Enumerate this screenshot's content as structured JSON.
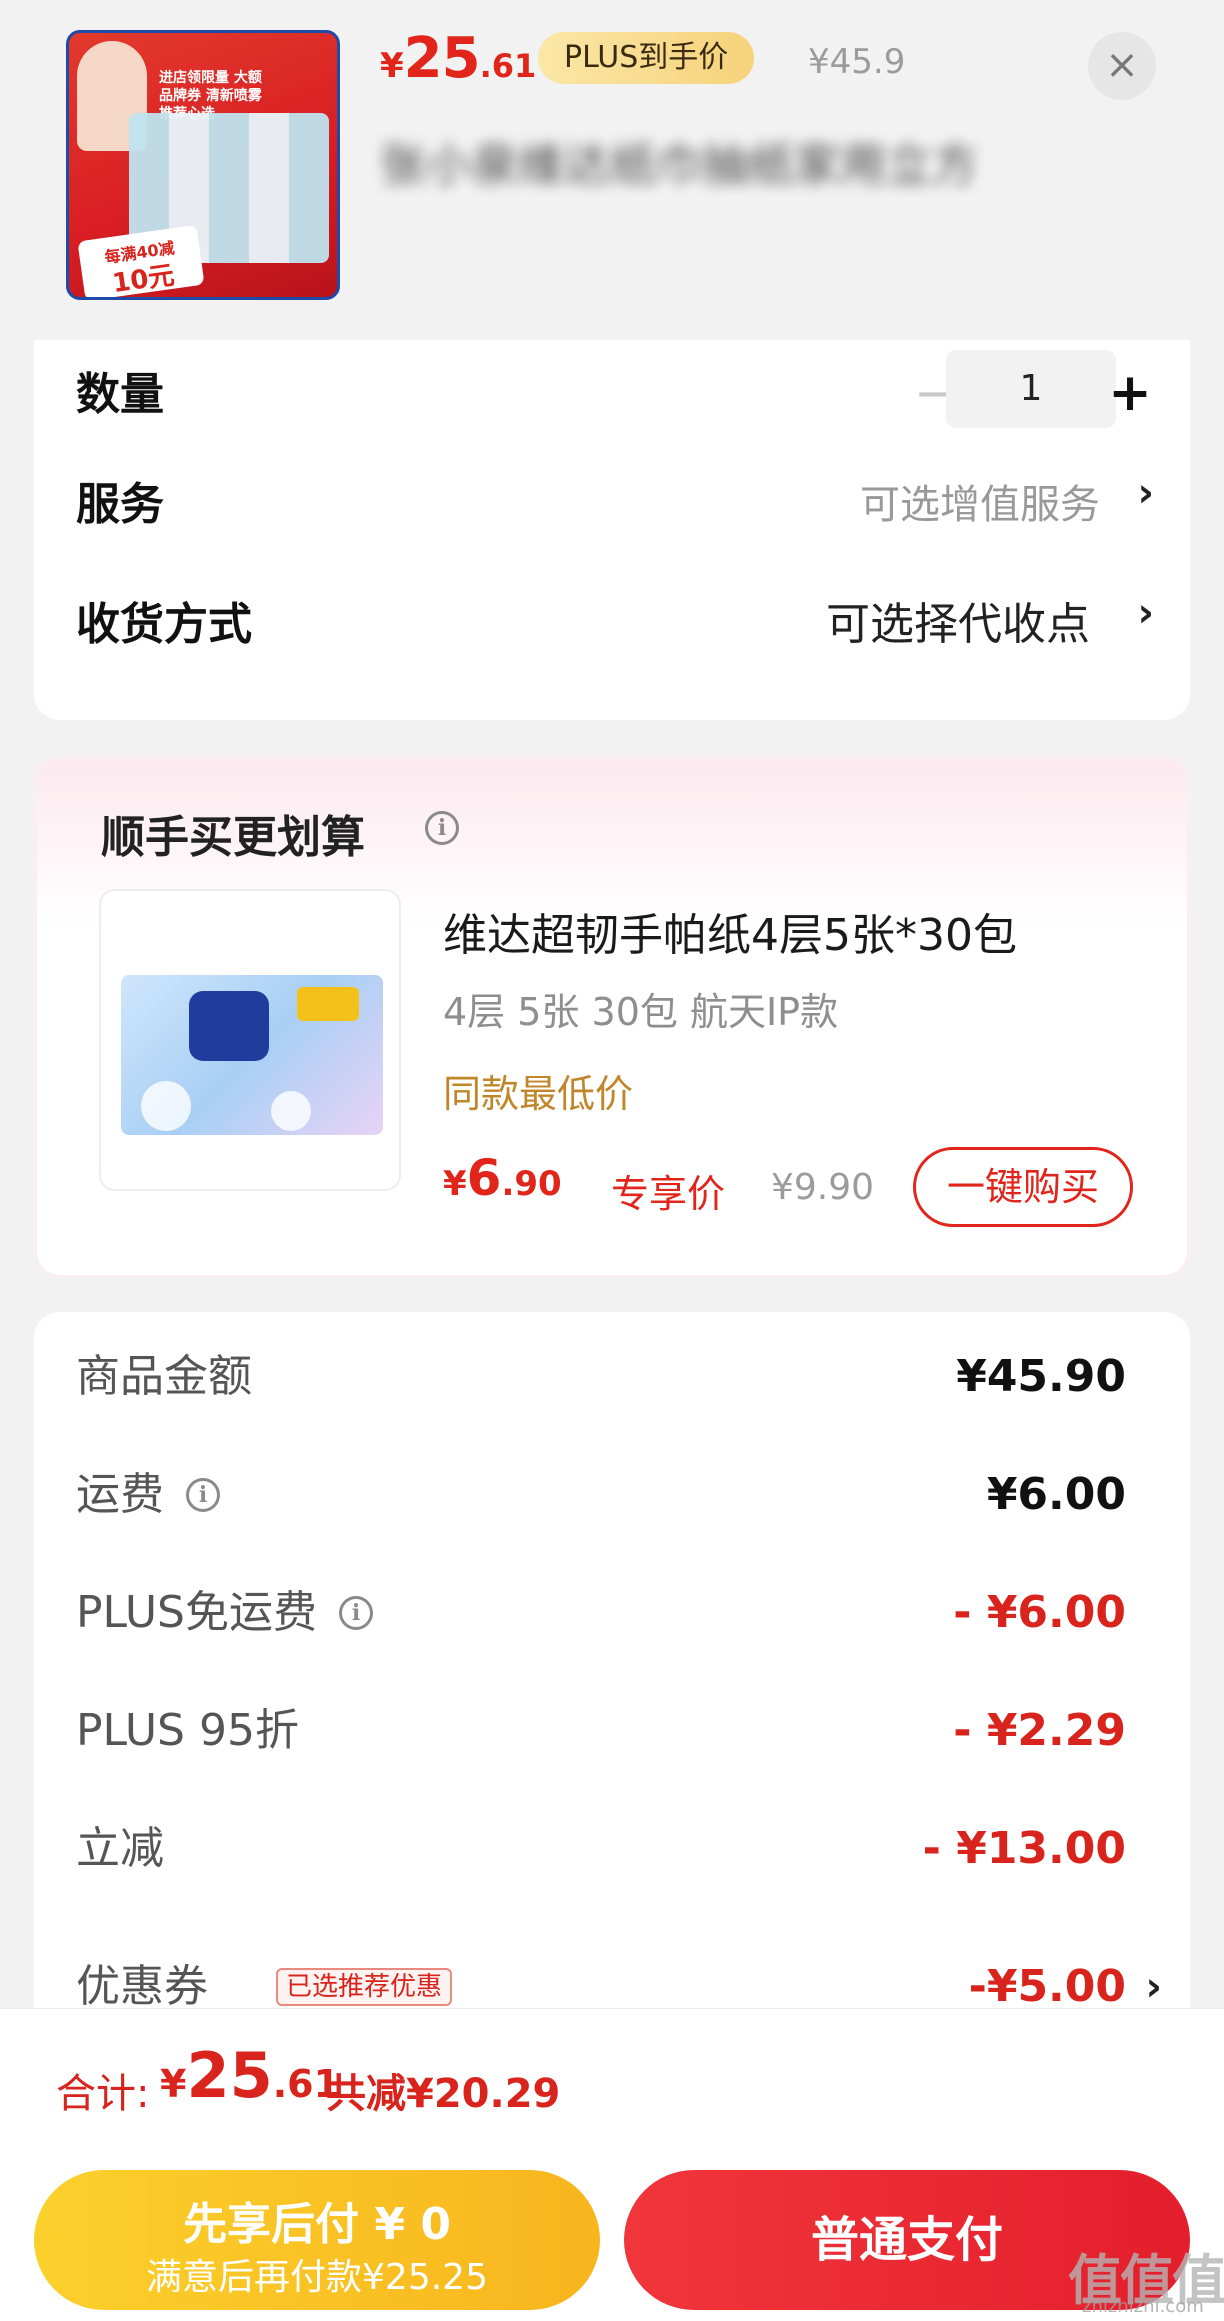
{
  "header": {
    "price": {
      "yen": "¥",
      "int": "25",
      "dec": ".61"
    },
    "plus_label": "PLUS到手价",
    "original_price": "¥45.9",
    "close_icon": "×",
    "title_blurred": "张小泉维达纸巾抽纸家用立方",
    "thumb": {
      "promo_text": "进店领限量 大额品牌券 清新喷雾 推荐心选",
      "tag_line1": "每满40减",
      "tag_line2": "10元"
    }
  },
  "options": {
    "quantity": {
      "label": "数量",
      "minus": "−",
      "value": "1",
      "plus": "+"
    },
    "service": {
      "label": "服务",
      "value": "可选增值服务",
      "chevron": "›"
    },
    "delivery": {
      "label": "收货方式",
      "value": "可选择代收点",
      "chevron": "›"
    }
  },
  "upsell": {
    "title": "顺手买更划算",
    "info_icon": "i",
    "product_name": "维达超韧手帕纸4层5张*30包",
    "spec": "4层 5张 30包 航天IP款",
    "tag": "同款最低价",
    "price": {
      "yen": "¥",
      "int": "6",
      "dec": ".90"
    },
    "exclusive_label": "专享价",
    "original_price": "¥9.90",
    "buy_button": "一键购买"
  },
  "summary": {
    "rows": [
      {
        "label": "商品金额",
        "value": "¥45.90",
        "info": false,
        "red": false
      },
      {
        "label": "运费",
        "value": "¥6.00",
        "info": true,
        "red": false
      },
      {
        "label": "PLUS免运费",
        "value": "- ¥6.00",
        "info": true,
        "red": true
      },
      {
        "label": "PLUS 95折",
        "value": "- ¥2.29",
        "info": false,
        "red": true
      },
      {
        "label": "立减",
        "value": "- ¥13.00",
        "info": false,
        "red": true
      }
    ],
    "coupon": {
      "label": "优惠券",
      "badge": "已选推荐优惠",
      "value": "-¥5.00",
      "chevron": "›"
    }
  },
  "total": {
    "label": "合计:",
    "price": {
      "yen": "¥",
      "int": "25",
      "dec": ".61"
    },
    "saved": "共减¥20.29"
  },
  "actions": {
    "pay_later_line1": "先享后付 ¥ 0",
    "pay_later_line2": "满意后再付款¥25.25",
    "pay_normal": "普通支付"
  },
  "watermark": {
    "main": "值值值",
    "sub": "zhizhizhi.com"
  },
  "colors": {
    "accent_red": "#e1251b",
    "gold": "#c0862a",
    "plus_pill": "#f6d27a",
    "pay_later": "#f8b51d"
  }
}
